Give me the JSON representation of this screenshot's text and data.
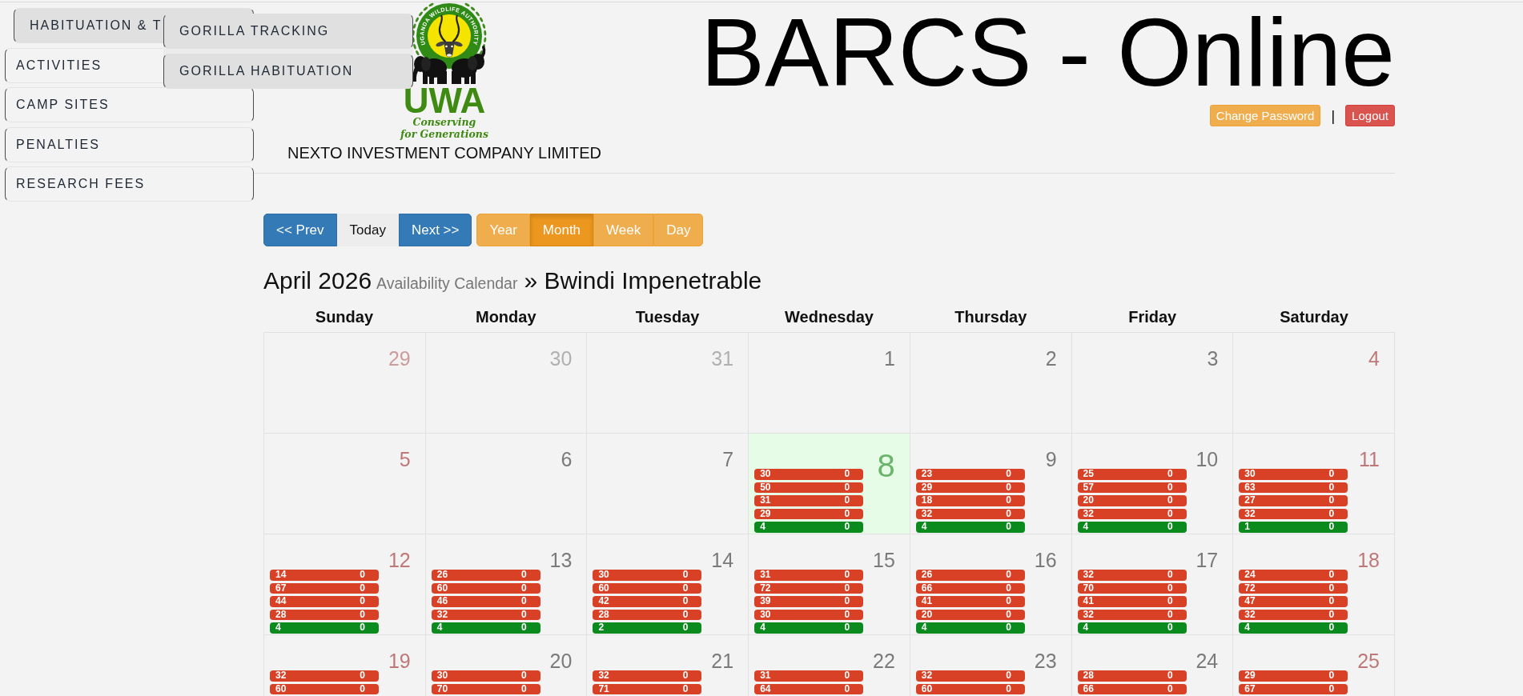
{
  "sidebar": {
    "items": [
      {
        "label": "HABITUATION & T",
        "expanded": true,
        "children": [
          {
            "label": "GORILLA TRACKING"
          },
          {
            "label": "GORILLA HABITUATION"
          }
        ]
      },
      {
        "label": "ACTIVITIES",
        "expanded": false
      },
      {
        "label": "CAMP SITES",
        "expanded": false
      },
      {
        "label": "PENALTIES",
        "expanded": false
      },
      {
        "label": "RESEARCH FEES",
        "expanded": false
      }
    ]
  },
  "header": {
    "logo": {
      "ring_text": "UGANDA WILDLIFE AUTHORITY",
      "wordmark": "UWA",
      "tagline": [
        "Conserving",
        "for Generations"
      ]
    },
    "company": "NEXTO INVESTMENT COMPANY LIMITED",
    "title": "BARCS - Online",
    "account_buttons": [
      {
        "label": "Change Password",
        "kind": "warning"
      },
      {
        "label": "Logout",
        "kind": "danger"
      }
    ],
    "separator": "|"
  },
  "toolbar": {
    "navigation": [
      {
        "label": "<< Prev",
        "kind": "primary"
      },
      {
        "label": "Today",
        "kind": "default"
      },
      {
        "label": "Next >>",
        "kind": "primary"
      }
    ],
    "views": [
      {
        "label": "Year",
        "selected": false
      },
      {
        "label": "Month",
        "selected": true
      },
      {
        "label": "Week",
        "selected": false
      },
      {
        "label": "Day",
        "selected": false
      }
    ]
  },
  "calendar": {
    "title": "April 2026",
    "subtitle": "Availability Calendar",
    "location": "» Bwindi Impenetrable",
    "weekdays": [
      {
        "label": "Sunday",
        "weekend": true
      },
      {
        "label": "Monday",
        "weekend": false
      },
      {
        "label": "Tuesday",
        "weekend": false
      },
      {
        "label": "Wednesday",
        "weekend": false
      },
      {
        "label": "Thursday",
        "weekend": false
      },
      {
        "label": "Friday",
        "weekend": false
      },
      {
        "label": "Saturday",
        "weekend": true
      }
    ],
    "weeks": [
      [
        {
          "date": "29",
          "kind": "outmonth"
        },
        {
          "date": "30",
          "kind": "outmonth"
        },
        {
          "date": "31",
          "kind": "outmonth"
        },
        {
          "date": "1",
          "kind": "day"
        },
        {
          "date": "2",
          "kind": "day"
        },
        {
          "date": "3",
          "kind": "day"
        },
        {
          "date": "4",
          "kind": "day"
        }
      ],
      [
        {
          "date": "5",
          "kind": "day"
        },
        {
          "date": "6",
          "kind": "day"
        },
        {
          "date": "7",
          "kind": "day"
        },
        {
          "date": "8",
          "kind": "today",
          "events": [
            {
              "label": "30",
              "value": "0",
              "color": "#d84126"
            },
            {
              "label": "50",
              "value": "0",
              "color": "#d84126"
            },
            {
              "label": "31",
              "value": "0",
              "color": "#d84126"
            },
            {
              "label": "29",
              "value": "0",
              "color": "#d84126"
            },
            {
              "label": "4",
              "value": "0",
              "color": "#0b8a1e"
            }
          ]
        },
        {
          "date": "9",
          "kind": "day",
          "events": [
            {
              "label": "23",
              "value": "0",
              "color": "#d84126"
            },
            {
              "label": "29",
              "value": "0",
              "color": "#d84126"
            },
            {
              "label": "18",
              "value": "0",
              "color": "#d84126"
            },
            {
              "label": "32",
              "value": "0",
              "color": "#d84126"
            },
            {
              "label": "4",
              "value": "0",
              "color": "#0b8a1e"
            }
          ]
        },
        {
          "date": "10",
          "kind": "day",
          "events": [
            {
              "label": "25",
              "value": "0",
              "color": "#d84126"
            },
            {
              "label": "57",
              "value": "0",
              "color": "#d84126"
            },
            {
              "label": "20",
              "value": "0",
              "color": "#d84126"
            },
            {
              "label": "32",
              "value": "0",
              "color": "#d84126"
            },
            {
              "label": "4",
              "value": "0",
              "color": "#0b8a1e"
            }
          ]
        },
        {
          "date": "11",
          "kind": "day",
          "events": [
            {
              "label": "30",
              "value": "0",
              "color": "#d84126"
            },
            {
              "label": "63",
              "value": "0",
              "color": "#d84126"
            },
            {
              "label": "27",
              "value": "0",
              "color": "#d84126"
            },
            {
              "label": "32",
              "value": "0",
              "color": "#d84126"
            },
            {
              "label": "1",
              "value": "0",
              "color": "#0b8a1e"
            }
          ]
        }
      ],
      [
        {
          "date": "12",
          "kind": "day",
          "events": [
            {
              "label": "14",
              "value": "0",
              "color": "#d84126"
            },
            {
              "label": "67",
              "value": "0",
              "color": "#d84126"
            },
            {
              "label": "44",
              "value": "0",
              "color": "#d84126"
            },
            {
              "label": "28",
              "value": "0",
              "color": "#d84126"
            },
            {
              "label": "4",
              "value": "0",
              "color": "#0b8a1e"
            }
          ]
        },
        {
          "date": "13",
          "kind": "day",
          "events": [
            {
              "label": "26",
              "value": "0",
              "color": "#d84126"
            },
            {
              "label": "60",
              "value": "0",
              "color": "#d84126"
            },
            {
              "label": "46",
              "value": "0",
              "color": "#d84126"
            },
            {
              "label": "32",
              "value": "0",
              "color": "#d84126"
            },
            {
              "label": "4",
              "value": "0",
              "color": "#0b8a1e"
            }
          ]
        },
        {
          "date": "14",
          "kind": "day",
          "events": [
            {
              "label": "30",
              "value": "0",
              "color": "#d84126"
            },
            {
              "label": "60",
              "value": "0",
              "color": "#d84126"
            },
            {
              "label": "42",
              "value": "0",
              "color": "#d84126"
            },
            {
              "label": "28",
              "value": "0",
              "color": "#d84126"
            },
            {
              "label": "2",
              "value": "0",
              "color": "#0b8a1e"
            }
          ]
        },
        {
          "date": "15",
          "kind": "day",
          "events": [
            {
              "label": "31",
              "value": "0",
              "color": "#d84126"
            },
            {
              "label": "72",
              "value": "0",
              "color": "#d84126"
            },
            {
              "label": "39",
              "value": "0",
              "color": "#d84126"
            },
            {
              "label": "30",
              "value": "0",
              "color": "#d84126"
            },
            {
              "label": "4",
              "value": "0",
              "color": "#0b8a1e"
            }
          ]
        },
        {
          "date": "16",
          "kind": "day",
          "events": [
            {
              "label": "26",
              "value": "0",
              "color": "#d84126"
            },
            {
              "label": "66",
              "value": "0",
              "color": "#d84126"
            },
            {
              "label": "41",
              "value": "0",
              "color": "#d84126"
            },
            {
              "label": "20",
              "value": "0",
              "color": "#d84126"
            },
            {
              "label": "4",
              "value": "0",
              "color": "#0b8a1e"
            }
          ]
        },
        {
          "date": "17",
          "kind": "day",
          "events": [
            {
              "label": "32",
              "value": "0",
              "color": "#d84126"
            },
            {
              "label": "70",
              "value": "0",
              "color": "#d84126"
            },
            {
              "label": "41",
              "value": "0",
              "color": "#d84126"
            },
            {
              "label": "32",
              "value": "0",
              "color": "#d84126"
            },
            {
              "label": "4",
              "value": "0",
              "color": "#0b8a1e"
            }
          ]
        },
        {
          "date": "18",
          "kind": "day",
          "events": [
            {
              "label": "24",
              "value": "0",
              "color": "#d84126"
            },
            {
              "label": "72",
              "value": "0",
              "color": "#d84126"
            },
            {
              "label": "47",
              "value": "0",
              "color": "#d84126"
            },
            {
              "label": "32",
              "value": "0",
              "color": "#d84126"
            },
            {
              "label": "4",
              "value": "0",
              "color": "#0b8a1e"
            }
          ]
        }
      ],
      [
        {
          "date": "19",
          "kind": "day",
          "events": [
            {
              "label": "32",
              "value": "0",
              "color": "#d84126"
            },
            {
              "label": "60",
              "value": "0",
              "color": "#d84126"
            }
          ]
        },
        {
          "date": "20",
          "kind": "day",
          "events": [
            {
              "label": "30",
              "value": "0",
              "color": "#d84126"
            },
            {
              "label": "70",
              "value": "0",
              "color": "#d84126"
            }
          ]
        },
        {
          "date": "21",
          "kind": "day",
          "events": [
            {
              "label": "32",
              "value": "0",
              "color": "#d84126"
            },
            {
              "label": "71",
              "value": "0",
              "color": "#d84126"
            }
          ]
        },
        {
          "date": "22",
          "kind": "day",
          "events": [
            {
              "label": "31",
              "value": "0",
              "color": "#d84126"
            },
            {
              "label": "64",
              "value": "0",
              "color": "#d84126"
            }
          ]
        },
        {
          "date": "23",
          "kind": "day",
          "events": [
            {
              "label": "32",
              "value": "0",
              "color": "#d84126"
            },
            {
              "label": "60",
              "value": "0",
              "color": "#d84126"
            }
          ]
        },
        {
          "date": "24",
          "kind": "day",
          "events": [
            {
              "label": "28",
              "value": "0",
              "color": "#d84126"
            },
            {
              "label": "66",
              "value": "0",
              "color": "#d84126"
            }
          ]
        },
        {
          "date": "25",
          "kind": "day",
          "events": [
            {
              "label": "29",
              "value": "0",
              "color": "#d84126"
            },
            {
              "label": "67",
              "value": "0",
              "color": "#d84126"
            }
          ]
        }
      ]
    ]
  }
}
